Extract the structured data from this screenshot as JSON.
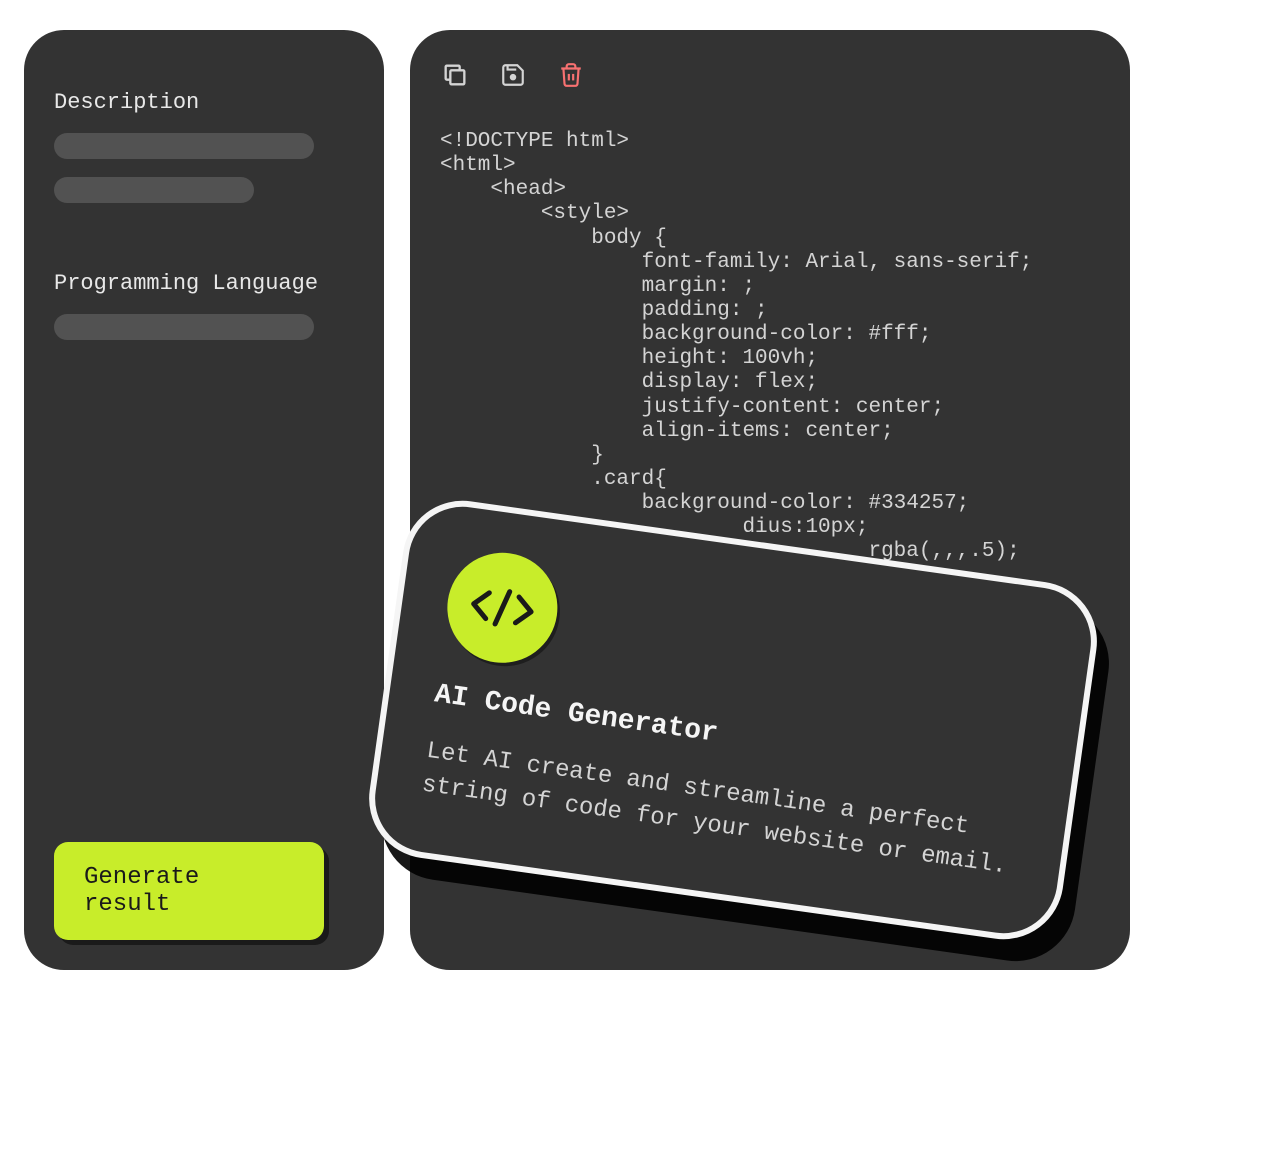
{
  "sidebar": {
    "description_label": "Description",
    "language_label": "Programming Language",
    "generate_button": "Generate result"
  },
  "code": {
    "content": "<!DOCTYPE html>\n<html>\n    <head>\n        <style>\n            body {\n                font-family: Arial, sans-serif;\n                margin: ;\n                padding: ;\n                background-color: #fff;\n                height: 100vh;\n                display: flex;\n                justify-content: center;\n                align-items: center;\n            }\n            .card{\n                background-color: #334257;\n                        dius:10px;\n                                  rgba(,,,.5);"
  },
  "toolbar": {
    "copy": "copy",
    "save": "save",
    "delete": "delete"
  },
  "promo": {
    "title": "AI Code Generator",
    "description": "Let AI create and streamline a perfect string of code for your website or email."
  },
  "colors": {
    "accent": "#c8ed2a",
    "panel": "#333333",
    "danger": "#f87171"
  }
}
